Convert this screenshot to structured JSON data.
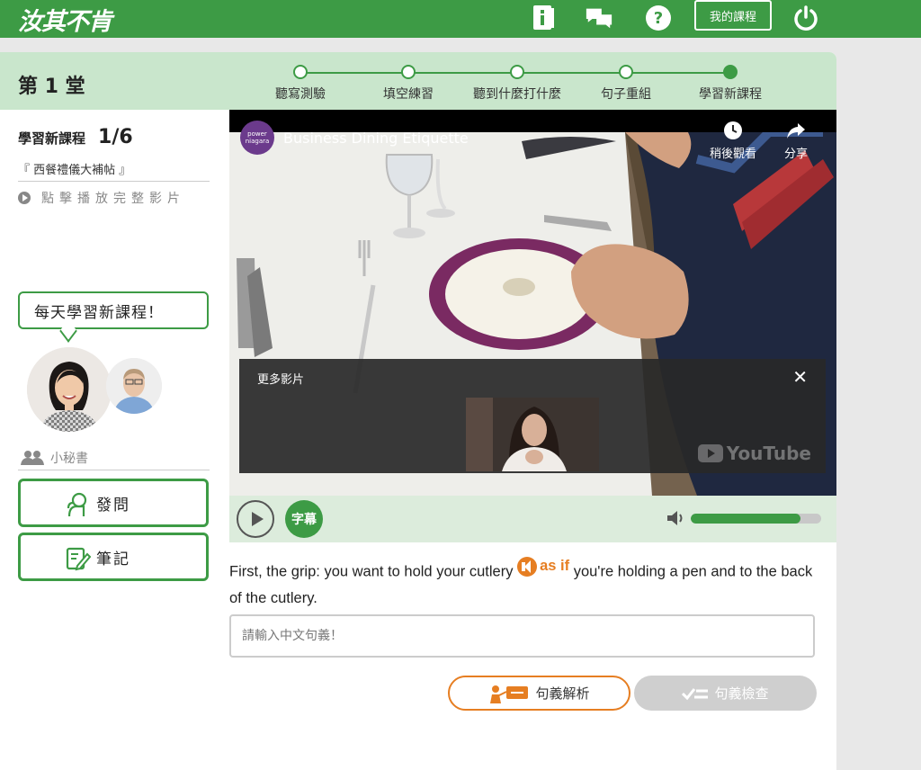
{
  "topbar": {
    "logo": "汝其不肯",
    "my_course_label": "我的課程"
  },
  "lesson": {
    "title": "第 1 堂",
    "steps": [
      {
        "label": "聽寫測驗",
        "active": false
      },
      {
        "label": "填空練習",
        "active": false
      },
      {
        "label": "聽到什麼打什麼",
        "active": false
      },
      {
        "label": "句子重組",
        "active": false
      },
      {
        "label": "學習新課程",
        "active": true
      }
    ]
  },
  "sidebar": {
    "course_label": "學習新課程",
    "course_progress": "1/6",
    "course_name": "『 西餐禮儀大補帖 』",
    "play_full": "點擊播放完整影片",
    "bubble": "每天學習新課程！",
    "secretary": "小秘書",
    "ask_button": "發問",
    "notes_button": "筆記"
  },
  "video": {
    "title": "Business Dining Etiquette",
    "channel": "power niagara",
    "watch_later": "稍後觀看",
    "share": "分享",
    "more_videos": "更多影片",
    "youtube": "YouTube"
  },
  "player": {
    "subtitle_button": "字幕",
    "volume": 0.84
  },
  "exercise": {
    "sentence_before": "First, the grip: you want to hold your cutlery",
    "highlight": "as if",
    "sentence_after": " you're holding a pen and to the back of the cutlery.",
    "input_placeholder": "請輸入中文句義！",
    "analysis_button": "句義解析",
    "check_button": "句義檢查"
  },
  "colors": {
    "brand_green": "#3d9b45",
    "light_green": "#c9e6cc",
    "accent_orange": "#e67e22"
  }
}
